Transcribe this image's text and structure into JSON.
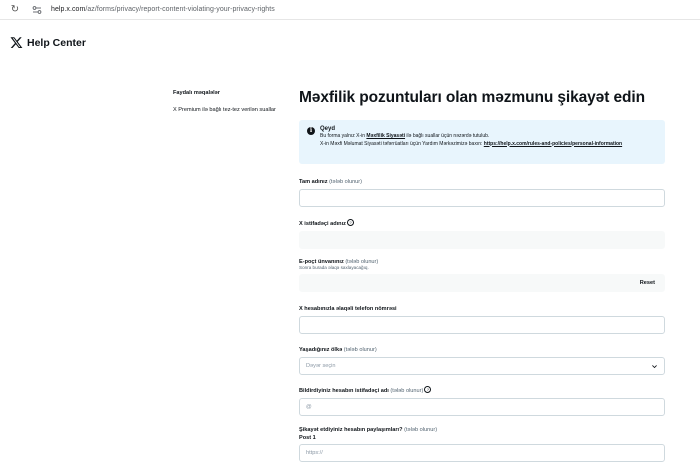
{
  "browser": {
    "url_host": "help.x.com",
    "url_path": "/az/forms/privacy/report-content-violating-your-privacy-rights"
  },
  "header": {
    "brand": "Help Center"
  },
  "sidebar": {
    "items": [
      {
        "label": "Faydalı məqalələr",
        "active": true
      },
      {
        "label": "X Premium ilə bağlı tez-tez verilən suallar",
        "active": false
      }
    ]
  },
  "main": {
    "title": "Məxfilik pozuntuları olan məzmunu şikayət edin",
    "note": {
      "title": "Qeyd",
      "line1_prefix": "Bu forma yalnız X-in ",
      "line1_link": "Məxfilik Siyasəti",
      "line1_suffix": " ilə bağlı suallar üçün nəzərdə tutulub.",
      "line2_prefix": "X-in Məxfi Məlumat Siyasəti təfərrüatları üçün Yardım Mərkəzimizə baxın: ",
      "line2_link": "https://help.x.com/rules-and-policies/personal-information"
    },
    "fields": {
      "full_name": {
        "label": "Tam adınız",
        "req": "(tələb olunur)",
        "value": ""
      },
      "username": {
        "label": "X istifadəçi adınız",
        "value": ""
      },
      "email": {
        "label": "E-poçt ünvanınız",
        "req": "(tələb olunur)",
        "hint": "Sonra burada əlaqə saxlayacağıq.",
        "reset_label": "Reset"
      },
      "phone": {
        "label": "X hesabınızla əlaqəli telefon nömrəsi",
        "value": ""
      },
      "country": {
        "label": "Yaşadığınız ölkə",
        "req": "(tələb olunur)",
        "placeholder": "Dəyər seçin"
      },
      "reported_username": {
        "label": "Bildirdiyiniz hesabın istifadəçi adı",
        "req": "(tələb olunur)",
        "placeholder": "@"
      },
      "posts": {
        "label": "Şikayət etdiyiniz hesabın paylaşımları?",
        "req": "(tələb olunur)",
        "post_label": "Post 1",
        "placeholder": "https://"
      }
    }
  },
  "colors": {
    "note_bg": "#e8f5fd",
    "border": "#cfd9de",
    "text": "#0f1419",
    "muted": "#536471"
  }
}
